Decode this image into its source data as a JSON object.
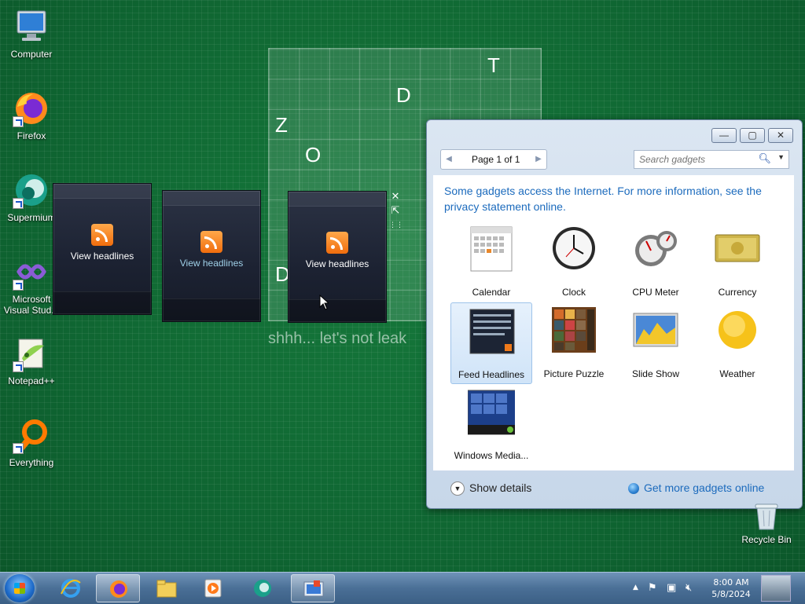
{
  "desktop": {
    "icons": [
      {
        "label": "Computer"
      },
      {
        "label": "Firefox"
      },
      {
        "label": "Supermium"
      },
      {
        "label": "Microsoft Visual Stud..."
      },
      {
        "label": "Notepad++"
      },
      {
        "label": "Everything"
      },
      {
        "label": "Recycle Bin"
      }
    ]
  },
  "grid_game": {
    "letters": [
      "T",
      "D",
      "Z",
      "O",
      "D"
    ],
    "caption": "shhh... let's not leak"
  },
  "feeds": [
    {
      "label": "View headlines"
    },
    {
      "label": "View headlines"
    },
    {
      "label": "View headlines"
    }
  ],
  "gadget_controls": {
    "close": "✕",
    "options": "⇱",
    "drag": "⋮⋮"
  },
  "gallery": {
    "window_buttons": {
      "minimize": "—",
      "maximize": "▢",
      "close": "✕"
    },
    "pager": {
      "text": "Page 1 of 1",
      "prev": "◀",
      "next": "▶"
    },
    "search": {
      "placeholder": "Search gadgets"
    },
    "notice": "Some gadgets access the Internet.  For more information, see the privacy statement online.",
    "gadgets": [
      {
        "label": "Calendar"
      },
      {
        "label": "Clock"
      },
      {
        "label": "CPU Meter"
      },
      {
        "label": "Currency"
      },
      {
        "label": "Feed Headlines"
      },
      {
        "label": "Picture Puzzle"
      },
      {
        "label": "Slide Show"
      },
      {
        "label": "Weather"
      },
      {
        "label": "Windows Media..."
      }
    ],
    "footer": {
      "show_details": "Show details",
      "more_online": "Get more gadgets online"
    }
  },
  "taskbar": {
    "clock": {
      "time": "8:00 AM",
      "date": "5/8/2024"
    }
  }
}
